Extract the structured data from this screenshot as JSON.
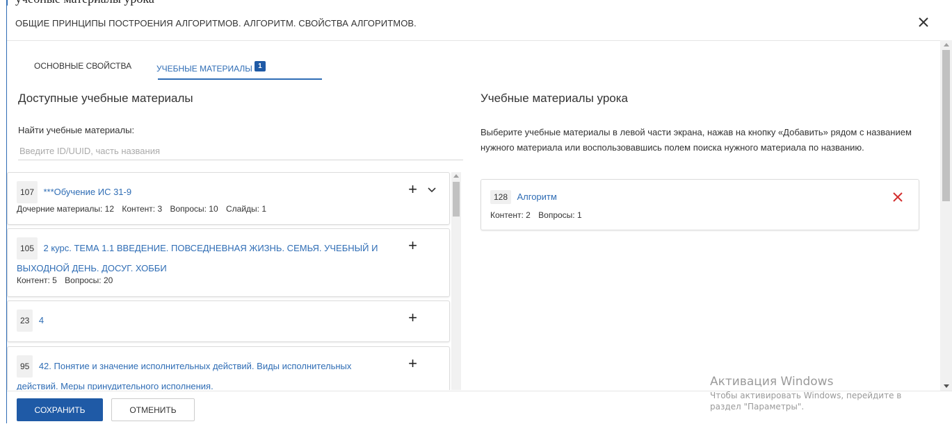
{
  "dialog": {
    "title": "ОБЩИЕ ПРИНЦИПЫ ПОСТРОЕНИЯ АЛГОРИТМОВ. АЛГОРИТМ. СВОЙСТВА АЛГОРИТМОВ.",
    "top_sliver_text": "учебные материалы урока"
  },
  "tabs": [
    {
      "label": "ОСНОВНЫЕ СВОЙСТВА",
      "active": false
    },
    {
      "label": "УЧЕБНЫЕ МАТЕРИАЛЫ",
      "badge": "1",
      "active": true
    }
  ],
  "available": {
    "title": "Доступные учебные материалы",
    "search_label": "Найти учебные материалы:",
    "search_placeholder": "Введите ID/UUID, часть названия",
    "items": [
      {
        "id": "107",
        "title": "***Обучение ИС 31-9",
        "stats": [
          "Дочерние материалы: 12",
          "Контент: 3",
          "Вопросы: 10",
          "Слайды: 1"
        ]
      },
      {
        "id": "105",
        "title": "2 курс. ТЕМА 1.1 ВВЕДЕНИЕ. ПОВСЕДНЕВНАЯ ЖИЗНЬ. СЕМЬЯ. УЧЕБНЫЙ И ВЫХОДНОЙ ДЕНЬ. ДОСУГ. ХОББИ",
        "stats": [
          "Контент: 5",
          "Вопросы: 20"
        ]
      },
      {
        "id": "23",
        "title": "4",
        "stats": []
      },
      {
        "id": "95",
        "title": "42. Понятие и значение исполнительных действий. Виды исполнительных действий. Меры принудительного исполнения.",
        "stats": []
      }
    ]
  },
  "lesson": {
    "title": "Учебные материалы урока",
    "description": "Выберите учебные материалы в левой части экрана, нажав на кнопку «Добавить» рядом с названием нужного материала или воспользовавшись полем поиска нужного материала по названию.",
    "items": [
      {
        "id": "128",
        "title": "Алгоритм",
        "stats": [
          "Контент: 2",
          "Вопросы: 1"
        ]
      }
    ]
  },
  "footer": {
    "save_label": "СОХРАНИТЬ",
    "cancel_label": "ОТМЕНИТЬ"
  },
  "watermark": {
    "title": "Активация Windows",
    "line1": "Чтобы активировать Windows, перейдите в",
    "line2": "раздел \"Параметры\"."
  },
  "colors": {
    "accent": "#2f6db5",
    "primary_button": "#1f5aa6",
    "remove": "#d32f2f"
  }
}
